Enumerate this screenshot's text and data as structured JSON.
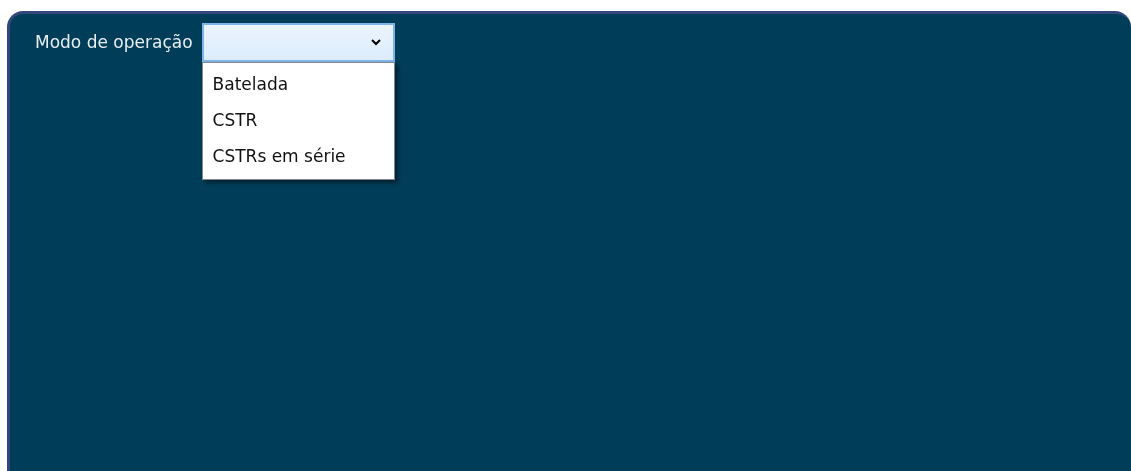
{
  "field": {
    "label": "Modo de operação",
    "expanded": true,
    "options": [
      {
        "label": "Batelada",
        "selected": false
      },
      {
        "label": "CSTR",
        "selected": false
      },
      {
        "label": "CSTRs em série",
        "selected": false
      }
    ]
  }
}
